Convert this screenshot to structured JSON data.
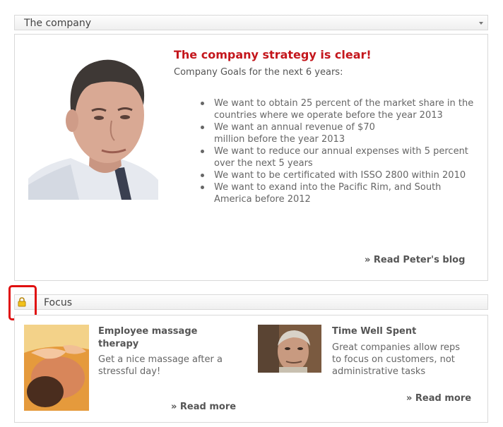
{
  "company_part": {
    "header_title": "The company",
    "strategy_title": "The company strategy is clear!",
    "subtitle": "Company Goals for the next 6 years:",
    "goals": [
      "We want to obtain 25 percent of the market share in the countries where we operate before the year 2013",
      "We want an annual revenue of $70 million before the year 2013",
      "We want to reduce our annual expenses with 5 percent over the next 5 years",
      "We want to be certificated with ISSO 2800 within 2010",
      "We want to exand into the Pacific Rim, and South America before 2012"
    ],
    "blog_link": "» Read Peter's blog"
  },
  "focus_part": {
    "header_title": "Focus",
    "items": [
      {
        "title": "Employee massage therapy",
        "description": "Get a nice massage after a stressful day!",
        "link": "» Read more"
      },
      {
        "title": "Time Well Spent",
        "description": "Great companies allow reps to focus on customers, not administrative tasks",
        "link": "» Read more"
      }
    ]
  },
  "colors": {
    "accent_red": "#c4161c",
    "highlight_red": "#e01010"
  }
}
